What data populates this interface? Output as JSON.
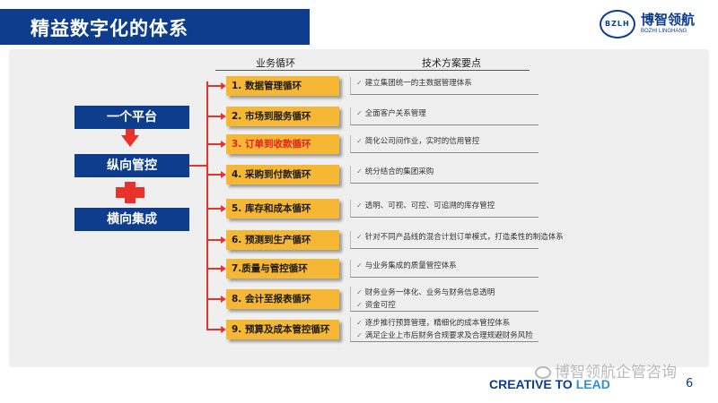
{
  "header": {
    "title": "精益数字化的体系"
  },
  "logo": {
    "mark": "BZLH",
    "name_cn": "博智领航",
    "name_en": "BOZHI LINGHANG"
  },
  "columns": {
    "cycle": "业务循环",
    "tech": "技术方案要点"
  },
  "left": {
    "platform": "一个平台",
    "vertical": "纵向管控",
    "horizontal": "横向集成"
  },
  "colors": {
    "accent_blue": "#0d3d8c",
    "accent_red": "#e8322b",
    "box_yellow": "#f6b735"
  },
  "cycles": [
    {
      "label": "1. 数据管理循环",
      "highlight": false,
      "points": [
        "建立集团统一的主数据管理体系"
      ]
    },
    {
      "label": "2. 市场到服务循环",
      "highlight": false,
      "points": [
        "全面客户关系管理"
      ]
    },
    {
      "label": "3. 订单到收款循环",
      "highlight": true,
      "points": [
        "简化公司间作业，实时的信用管控"
      ]
    },
    {
      "label": "4. 采购到付款循环",
      "highlight": false,
      "points": [
        "统分结合的集团采购"
      ]
    },
    {
      "label": "5. 库存和成本循环",
      "highlight": false,
      "points": [
        "透明、可视、可控、可追溯的库存管控"
      ]
    },
    {
      "label": "6. 预测到生产循环",
      "highlight": false,
      "points": [
        "针对不同产品线的混合计划订单模式，打造柔性的制造体系"
      ]
    },
    {
      "label": "7.质量与管控循环",
      "highlight": false,
      "points": [
        "与业务集成的质量管控体系"
      ]
    },
    {
      "label": "8. 会计至报表循环",
      "highlight": false,
      "points": [
        "财务业务一体化、业务与财务信息透明",
        "资金可控"
      ]
    },
    {
      "label": "9. 预算及成本管控循环",
      "highlight": false,
      "points": [
        "逐步推行预算管理，精细化的成本管控体系",
        "满足企业上市后财务合规要求及合理规避财务风险"
      ]
    }
  ],
  "footer": {
    "watermark": "博智领航企管咨询",
    "slogan_a": "CREATIVE TO ",
    "slogan_b": "LEAD",
    "page": "6"
  }
}
